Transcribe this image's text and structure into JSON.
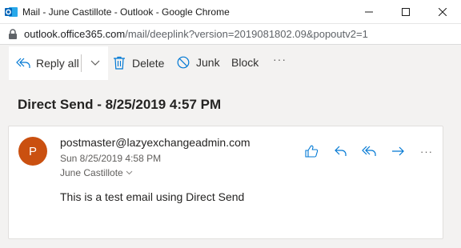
{
  "window": {
    "title": "Mail - June Castillote - Outlook - Google Chrome",
    "app_icon": "outlook-icon",
    "accent": "#0078d4"
  },
  "address_bar": {
    "host": "outlook.office365.com",
    "path": "/mail/deeplink?version=2019081802.09&popoutv2=1"
  },
  "toolbar": {
    "reply_all_label": "Reply all",
    "delete_label": "Delete",
    "junk_label": "Junk",
    "block_label": "Block",
    "more_label": "···"
  },
  "message": {
    "subject": "Direct Send - 8/25/2019 4:57 PM",
    "avatar_letter": "P",
    "avatar_color": "#ca5010",
    "sender": "postmaster@lazyexchangeadmin.com",
    "date": "Sun 8/25/2019 4:58 PM",
    "to": "June Castillote",
    "body": "This is a test email using Direct Send",
    "more_label": "···"
  }
}
